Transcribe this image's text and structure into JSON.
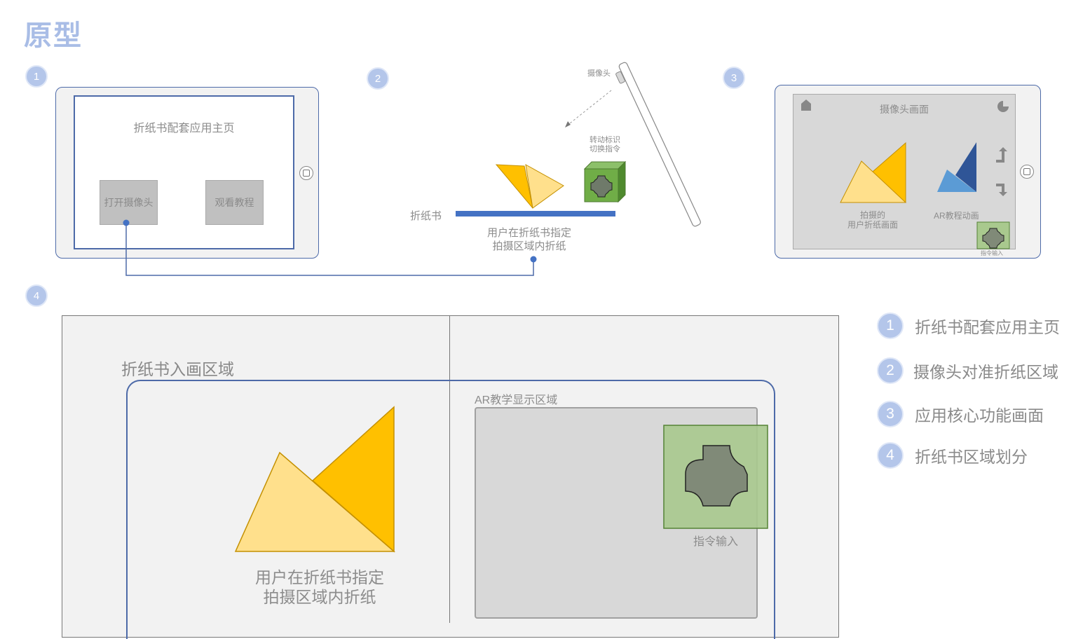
{
  "page_title": "原型",
  "badges": [
    "1",
    "2",
    "3",
    "4"
  ],
  "panel1": {
    "screen_title": "折纸书配套应用主页",
    "open_camera_button": "打开摄像头",
    "watch_tutorial_button": "观看教程"
  },
  "panel2": {
    "camera_label": "摄像头",
    "cube_label_line1": "转动标识",
    "cube_label_line2": "切换指令",
    "book_label": "折纸书",
    "caption_line1": "用户在折纸书指定",
    "caption_line2": "拍摄区域内折纸"
  },
  "panel3": {
    "screen_title": "摄像头画面",
    "captured_line1": "拍摄的",
    "captured_line2": "用户折纸画面",
    "ar_animation": "AR教程动画",
    "command_input": "指令输入"
  },
  "panel4": {
    "book_area_label": "折纸书入画区域",
    "ar_area_label": "AR教学显示区域",
    "command_input": "指令输入",
    "caption_line1": "用户在折纸书指定",
    "caption_line2": "拍摄区域内折纸"
  },
  "legend": [
    {
      "num": "1",
      "text": "折纸书配套应用主页"
    },
    {
      "num": "2",
      "text": "摄像头对准折纸区域"
    },
    {
      "num": "3",
      "text": "应用核心功能画面"
    },
    {
      "num": "4",
      "text": "折纸书区域划分"
    }
  ],
  "colors": {
    "accent_blue": "#4d6aa8",
    "badge": "#b4c6ea",
    "title": "#a9bde6",
    "paper_light": "#ffe08c",
    "paper_dark": "#ffc000",
    "ar_light": "#5b9bd5",
    "ar_dark": "#2f5597",
    "cube_green": "#70ad47",
    "marker_gray": "#808a78"
  }
}
